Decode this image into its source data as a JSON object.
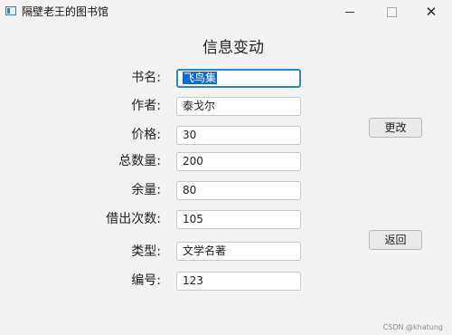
{
  "window": {
    "title": "隔壁老王的图书馆",
    "min_symbol": "",
    "close_symbol": "✕"
  },
  "heading": "信息变动",
  "fields": [
    {
      "label": "书名:",
      "value": "飞鸟集"
    },
    {
      "label": "作者:",
      "value": "泰戈尔"
    },
    {
      "label": "价格:",
      "value": "30"
    },
    {
      "label": "总数量:",
      "value": "200"
    },
    {
      "label": "余量:",
      "value": "80"
    },
    {
      "label": "借出次数:",
      "value": "105"
    },
    {
      "label": "类型:",
      "value": "文学名著"
    },
    {
      "label": "编号:",
      "value": "123"
    }
  ],
  "buttons": {
    "update": "更改",
    "back": "返回"
  },
  "watermark": "CSDN @khatung",
  "colors": {
    "focus_border": "#2a86c8",
    "selection": "#0a6dd9"
  }
}
